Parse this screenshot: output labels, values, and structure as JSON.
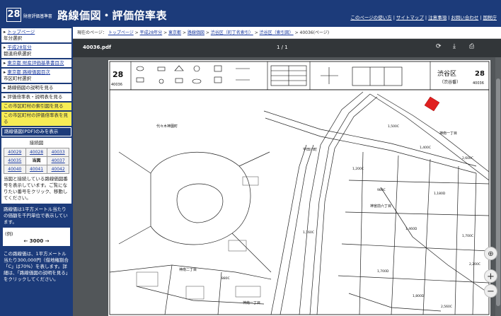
{
  "header": {
    "logo_number": "28",
    "logo_subtitle": "財産評価基準書",
    "title": "路線価図・評価倍率表",
    "links": [
      "このページの使い方",
      "サイトマップ",
      "注意事項",
      "お問い合わせ",
      "国税庁"
    ]
  },
  "sidebar": {
    "nav": [
      {
        "link": "トップページ",
        "sub": "年分選択"
      },
      {
        "link": "平成28年分",
        "sub": "都道府県選択"
      },
      {
        "link": "東京都 財産評価基準書目次",
        "sub": ""
      },
      {
        "link": "東京都 路線価図目次",
        "sub": "市区町村選択"
      },
      {
        "link": "",
        "sub": "路線価図の説明を見る"
      },
      {
        "link": "",
        "sub": "評価倍率表・説明表を見る"
      }
    ],
    "yellow_items": [
      "この市区町村の索引図を見る",
      "この市区町村の評価倍率表を見る"
    ],
    "blue_item": "路線価図(PDF)のみを表示",
    "adjacent_title": "接続図",
    "adjacent_grid": [
      "40029",
      "40028",
      "40033",
      "40035",
      "当図",
      "40037",
      "40040",
      "40041",
      "40042"
    ],
    "adjacent_note": "当図と接続している路線価図番号を表示しています。ご覧になりたい番号をクリック、移動してください。",
    "value_note": "路線価は1平方メートル当たりの価額を千円単位で表示しています。",
    "example_label": "(例)",
    "example_value": "3000",
    "example_detail": "この路線価は、1平方メートル当たり300,000円（借地権割合「C」は70%）を表します。詳細は、「路線価図の説明を見る」をクリックしてください。"
  },
  "breadcrumb": {
    "prefix": "現在のページ：",
    "crumbs": [
      "トップページ",
      "平成28年分",
      "東京都",
      "路線価図",
      "渋谷区",
      "（町丁名索引）",
      "渋谷区",
      "（索引図）"
    ],
    "current": "40036(ページ)"
  },
  "viewer": {
    "filename": "40036.pdf",
    "page_indicator": "1 / 1",
    "icons": [
      "rotate-icon",
      "download-icon",
      "print-icon"
    ],
    "zoom_in": "+",
    "zoom_out": "−"
  },
  "map": {
    "pref_number": "28",
    "sheet_number": "40036",
    "ward": "渋谷区",
    "ward_sub": "（渋谷番）",
    "area_labels": [
      "代々木神園町",
      "神南二丁目",
      "神南一丁目",
      "神宮前六丁目",
      "宇田川町",
      "神南一丁目"
    ],
    "road_values": [
      "1,500C",
      "1,400C",
      "1,200C",
      "2,600C",
      "980C",
      "1,180D",
      "1,160C",
      "1,460D",
      "1,700C",
      "2,200C",
      "880C",
      "1,700D",
      "1,800D",
      "2,560C"
    ]
  }
}
